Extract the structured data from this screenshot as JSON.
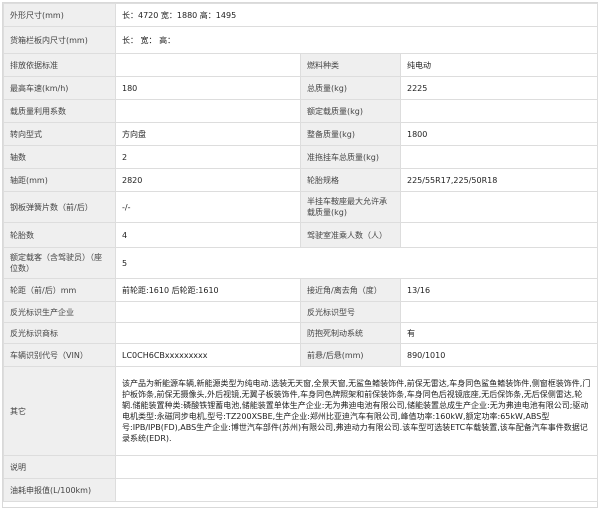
{
  "rows": {
    "dims": {
      "label": "外形尺寸(mm)",
      "value": "长：4720 宽：1880 高：1495"
    },
    "cargo": {
      "label": "货箱栏板内尺寸(mm)",
      "value": "长：  宽：  高："
    },
    "emission": {
      "label": "排放依据标准",
      "value": "",
      "label2": "燃料种类",
      "value2": "纯电动"
    },
    "speed": {
      "label": "最高车速(km/h)",
      "value": "180",
      "label2": "总质量(kg)",
      "value2": "2225"
    },
    "loadfactor": {
      "label": "载质量利用系数",
      "value": "",
      "label2": "额定载质量(kg)",
      "value2": ""
    },
    "steering": {
      "label": "转向型式",
      "value": "方向盘",
      "label2": "整备质量(kg)",
      "value2": "1800"
    },
    "axles": {
      "label": "轴数",
      "value": "2",
      "label2": "准拖挂车总质量(kg)",
      "value2": ""
    },
    "wheelbase": {
      "label": "轴距(mm)",
      "value": "2820",
      "label2": "轮胎规格",
      "value2": "225/55R17,225/50R18"
    },
    "springs": {
      "label": "钢板弹簧片数（前/后）",
      "value": "-/-",
      "label2": "半挂车鞍座最大允许承载质量(kg)",
      "value2": ""
    },
    "tires": {
      "label": "轮胎数",
      "value": "4",
      "label2": "驾驶室准乘人数（人）",
      "value2": ""
    },
    "seats": {
      "label": "额定载客（含驾驶员）（座位数）",
      "value": "5"
    },
    "track": {
      "label": "轮距（前/后）mm",
      "value": "前轮距:1610 后轮距:1610",
      "label2": "接近角/离去角（度）",
      "value2": "13/16"
    },
    "reflector_maker": {
      "label": "反光标识生产企业",
      "value": "",
      "label2": "反光标识型号",
      "value2": ""
    },
    "reflector_brand": {
      "label": "反光标识商标",
      "value": "",
      "label2": "防抱死制动系统",
      "value2": "有"
    },
    "vin": {
      "label": "车辆识别代号（VIN）",
      "value": "LC0CH6CBxxxxxxxxx",
      "label2": "前悬/后悬(mm)",
      "value2": "890/1010"
    },
    "other": {
      "label": "其它",
      "value": "该产品为新能源车辆,新能源类型为纯电动.选装无天窗,全景天窗,无鲨鱼鳍装饰件,前保无雷达,车身同色鲨鱼鳍装饰件,侧窗框装饰件,门护板饰条,前保无摄像头,外后视镜,无翼子板装饰件,车身同色牌照架和前保装饰条,车身同色后视镜底座,无后保饰条,无后保侧雷达,轮辋.储能装置种类:磷酸铁锂蓄电池,储能装置单体生产企业:无为弗迪电池有限公司,储能装置总成生产企业:无为弗迪电池有限公司;驱动电机类型:永磁同步电机,型号:TZ200XSBE,生产企业:郑州比亚迪汽车有限公司,峰值功率:160kW,额定功率:65kW,ABS型号:IPB/IPB(FD),ABS生产企业:博世汽车部件(苏州)有限公司,弗迪动力有限公司.该车型可选装ETC车载装置,该车配备汽车事件数据记录系统(EDR)."
    },
    "remark": {
      "label": "说明",
      "value": ""
    },
    "fuel": {
      "label": "油耗申报值(L/100km)",
      "value": ""
    }
  }
}
